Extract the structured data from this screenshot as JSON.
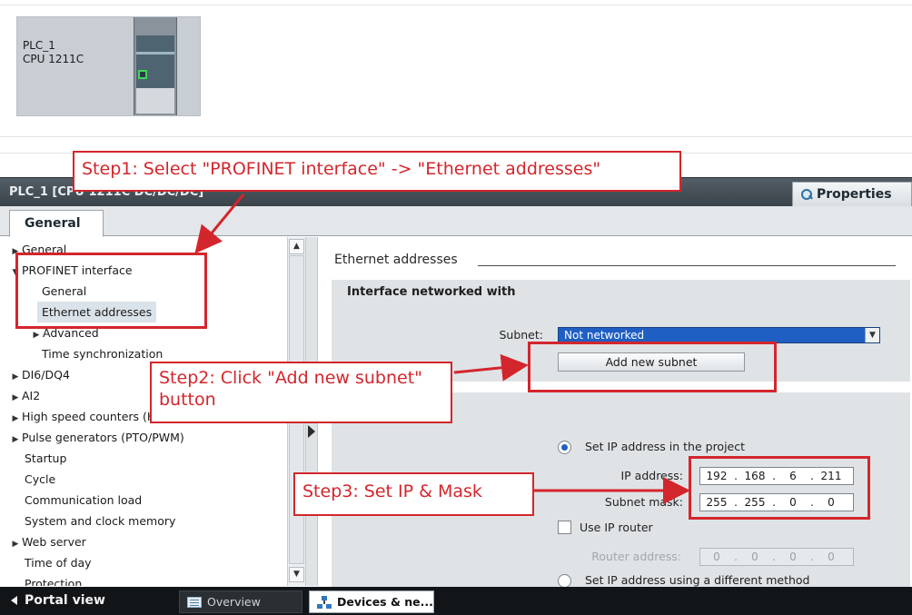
{
  "device": {
    "name": "PLC_1",
    "type": "CPU 1211C"
  },
  "inspector": {
    "title": "PLC_1 [CPU 1211C DC/DC/DC]",
    "properties_tab": "Properties",
    "general_tab": "General"
  },
  "nav": {
    "items": [
      {
        "label": "General",
        "arrow": "▶"
      },
      {
        "label": "PROFINET interface",
        "arrow": "▼"
      },
      {
        "label": "General",
        "arrow": ""
      },
      {
        "label": "Ethernet addresses",
        "arrow": ""
      },
      {
        "label": "Advanced",
        "arrow": "▶"
      },
      {
        "label": "Time synchronization",
        "arrow": ""
      },
      {
        "label": "DI6/DQ4",
        "arrow": "▶"
      },
      {
        "label": "AI2",
        "arrow": "▶"
      },
      {
        "label": "High speed counters (HSC)",
        "arrow": "▶"
      },
      {
        "label": "Pulse generators (PTO/PWM)",
        "arrow": "▶"
      },
      {
        "label": "Startup",
        "arrow": ""
      },
      {
        "label": "Cycle",
        "arrow": ""
      },
      {
        "label": "Communication load",
        "arrow": ""
      },
      {
        "label": "System and clock memory",
        "arrow": ""
      },
      {
        "label": "Web server",
        "arrow": "▶"
      },
      {
        "label": "Time of day",
        "arrow": ""
      },
      {
        "label": "Protection",
        "arrow": ""
      }
    ]
  },
  "content": {
    "section_title": "Ethernet addresses",
    "interface_group_title": "Interface networked with",
    "subnet_label": "Subnet:",
    "subnet_value": "Not networked",
    "add_subnet_button": "Add new subnet",
    "set_ip_in_project": "Set IP address in the project",
    "ip_label": "IP address:",
    "ip": [
      "192",
      "168",
      "6",
      "211"
    ],
    "mask_label": "Subnet mask:",
    "mask": [
      "255",
      "255",
      "0",
      "0"
    ],
    "use_router": "Use IP router",
    "router_label": "Router address:",
    "router": [
      "0",
      "0",
      "0",
      "0"
    ],
    "set_ip_other": "Set IP address using a different method"
  },
  "taskbar": {
    "portal_view": "Portal view",
    "overview": "Overview",
    "devices": "Devices & ne..."
  },
  "callouts": {
    "step1": "Step1: Select \"PROFINET interface\" -> \"Ethernet addresses\"",
    "step2": "Step2: Click \"Add new subnet\" button",
    "step3": "Step3: Set IP & Mask"
  },
  "colors": {
    "callout_red": "#d3262c",
    "selection_blue": "#1f5fc4",
    "taskbar": "#121518"
  }
}
